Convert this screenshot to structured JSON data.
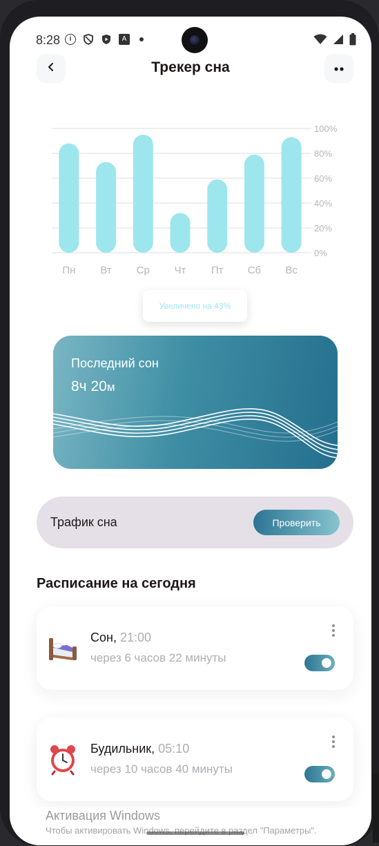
{
  "status_bar": {
    "time": "8:28",
    "info_icon": "info-icon",
    "shield_icon": "shield-icon",
    "play_icon": "play-protect-icon",
    "text_icon": "a-icon",
    "wifi_icon": "wifi-icon",
    "signal_icon": "signal-icon",
    "battery_icon": "battery-icon"
  },
  "header": {
    "title": "Трекер сна",
    "back_icon": "chevron-left-icon",
    "more_icon": "more-dots-icon"
  },
  "chart_data": {
    "type": "bar",
    "categories": [
      "Пн",
      "Вт",
      "Ср",
      "Чт",
      "Пт",
      "Сб",
      "Вс"
    ],
    "values": [
      88,
      73,
      95,
      32,
      59,
      79,
      93
    ],
    "y_ticks": [
      "100%",
      "80%",
      "60%",
      "40%",
      "20%",
      "0%"
    ],
    "ylim": [
      0,
      100
    ],
    "bar_color": "#9ee6ee",
    "grid": true,
    "title": ""
  },
  "tooltip": {
    "text": "Увеличено на 43%"
  },
  "last_sleep": {
    "title": "Последний сон",
    "hours": "8ч",
    "minutes": "20",
    "minutes_unit": "м"
  },
  "traffic": {
    "label": "Трафик сна",
    "button": "Проверить"
  },
  "schedule": {
    "title": "Расписание на сегодня",
    "items": [
      {
        "icon": "bed-icon",
        "name": "Сон,",
        "time": "21:00",
        "remaining": "через 6 часов 22 минуты",
        "enabled": true
      },
      {
        "icon": "alarm-clock-icon",
        "name": "Будильник,",
        "time": "05:10",
        "remaining": "через 10 часов 40 минуты",
        "enabled": true
      }
    ]
  },
  "windows_watermark": {
    "title": "Активация Windows",
    "subtitle": "Чтобы активировать Windows, перейдите в раздел \"Параметры\"."
  },
  "colors": {
    "accent": "#9ee6ee",
    "primary": "#2d7594",
    "text": "#1d1617",
    "muted": "#adaeb3"
  }
}
